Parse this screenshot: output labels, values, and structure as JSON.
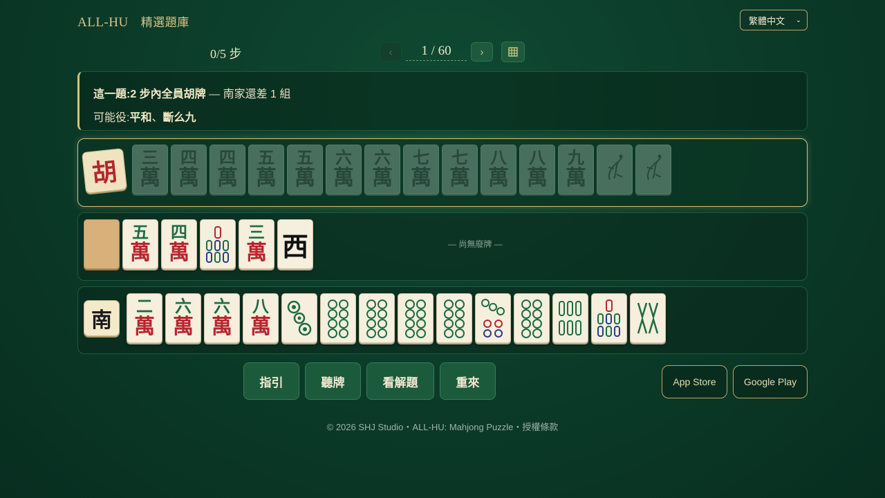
{
  "header": {
    "brand": "ALL-HU",
    "subtitle": "精選題庫",
    "language": "繁體中文"
  },
  "progress": {
    "steps": "0/5 步",
    "page": "1 / 60",
    "prev": "‹",
    "next": "›"
  },
  "hint": {
    "line1_bold": "這一題:2 步內全員胡牌",
    "line1_rest": " — 南家還差 1 組",
    "line2_prefix": "可能役:",
    "line2_yaku1": "平和",
    "line2_sep": "、",
    "line2_yaku2": "斷么九"
  },
  "rows": {
    "hu": {
      "seat": "胡",
      "tiles": [
        {
          "n": "三",
          "w": "萬"
        },
        {
          "n": "四",
          "w": "萬"
        },
        {
          "n": "四",
          "w": "萬"
        },
        {
          "n": "五",
          "w": "萬"
        },
        {
          "n": "五",
          "w": "萬"
        },
        {
          "n": "六",
          "w": "萬"
        },
        {
          "n": "六",
          "w": "萬"
        },
        {
          "n": "七",
          "w": "萬"
        },
        {
          "n": "七",
          "w": "萬"
        },
        {
          "n": "八",
          "w": "萬"
        },
        {
          "n": "八",
          "w": "萬"
        },
        {
          "n": "九",
          "w": "萬"
        }
      ],
      "bird_icons": [
        "bird-icon",
        "bird-icon"
      ]
    },
    "opponent": {
      "tiles": [
        {
          "n": "五",
          "w": "萬"
        },
        {
          "n": "四",
          "w": "萬"
        }
      ],
      "tiles_after": [
        {
          "n": "三",
          "w": "萬"
        }
      ],
      "honor": "西",
      "no_discard": "— 尚無廢牌 —"
    },
    "south": {
      "seat": "南",
      "tiles": [
        {
          "n": "二",
          "w": "萬"
        },
        {
          "n": "六",
          "w": "萬"
        },
        {
          "n": "六",
          "w": "萬"
        },
        {
          "n": "八",
          "w": "萬"
        }
      ]
    }
  },
  "actions": {
    "guide": "指引",
    "listen": "聽牌",
    "solution": "看解題",
    "restart": "重來",
    "app_store": "App Store",
    "google_play": "Google Play"
  },
  "footer": "© 2026 SHJ Studio・ALL-HU: Mahjong Puzzle・授權條款",
  "colors": {
    "accent_gold": "#d8c07c",
    "felt": "#0b3a28",
    "wan_red": "#b8262f",
    "num_green": "#1e6b44"
  }
}
